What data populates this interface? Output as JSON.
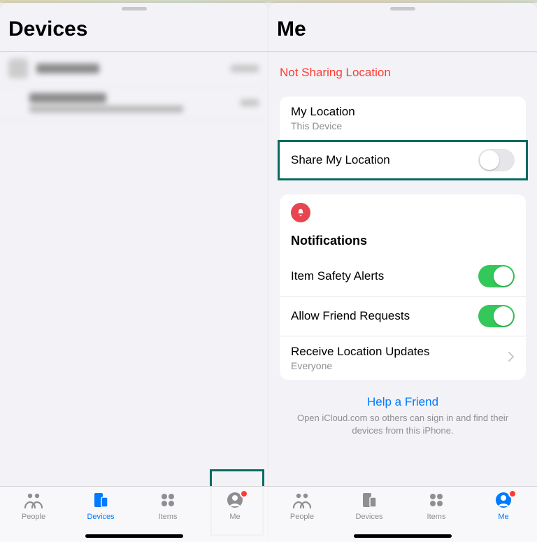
{
  "colors": {
    "accent": "#007aff",
    "danger": "#ff3b30",
    "switch_on": "#34c759",
    "highlight": "#0a6a60"
  },
  "left_panel": {
    "title": "Devices",
    "tabs": {
      "people": "People",
      "devices": "Devices",
      "items": "Items",
      "me": "Me",
      "active": "devices"
    }
  },
  "right_panel": {
    "title": "Me",
    "status": "Not Sharing Location",
    "location_card": {
      "my_location_label": "My Location",
      "my_location_sub": "This Device",
      "share_label": "Share My Location",
      "share_enabled": false
    },
    "notifications": {
      "section_title": "Notifications",
      "item_safety_label": "Item Safety Alerts",
      "item_safety_enabled": true,
      "friend_requests_label": "Allow Friend Requests",
      "friend_requests_enabled": true,
      "receive_updates_label": "Receive Location Updates",
      "receive_updates_sub": "Everyone"
    },
    "help_link": "Help a Friend",
    "help_sub": "Open iCloud.com so others can sign in and find their devices from this iPhone.",
    "tabs": {
      "people": "People",
      "devices": "Devices",
      "items": "Items",
      "me": "Me",
      "active": "me"
    }
  }
}
